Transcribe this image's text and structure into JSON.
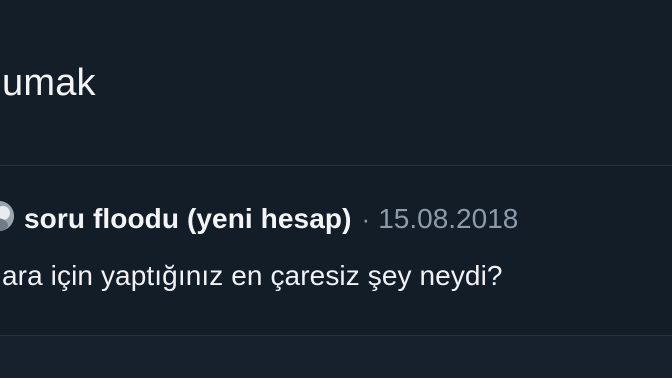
{
  "tweet": {
    "text": "umak"
  },
  "quoted": {
    "author": "soru floodu (yeni hesap)",
    "separator": "·",
    "date": "15.08.2018",
    "question": "ara için yaptığınız en çaresiz şey neydi?"
  },
  "colors": {
    "background": "#141e29",
    "text": "#f4f5f7",
    "secondary_text": "#8d9ba8",
    "divider": "#243341"
  },
  "icons": {
    "avatar": "profile-avatar"
  }
}
